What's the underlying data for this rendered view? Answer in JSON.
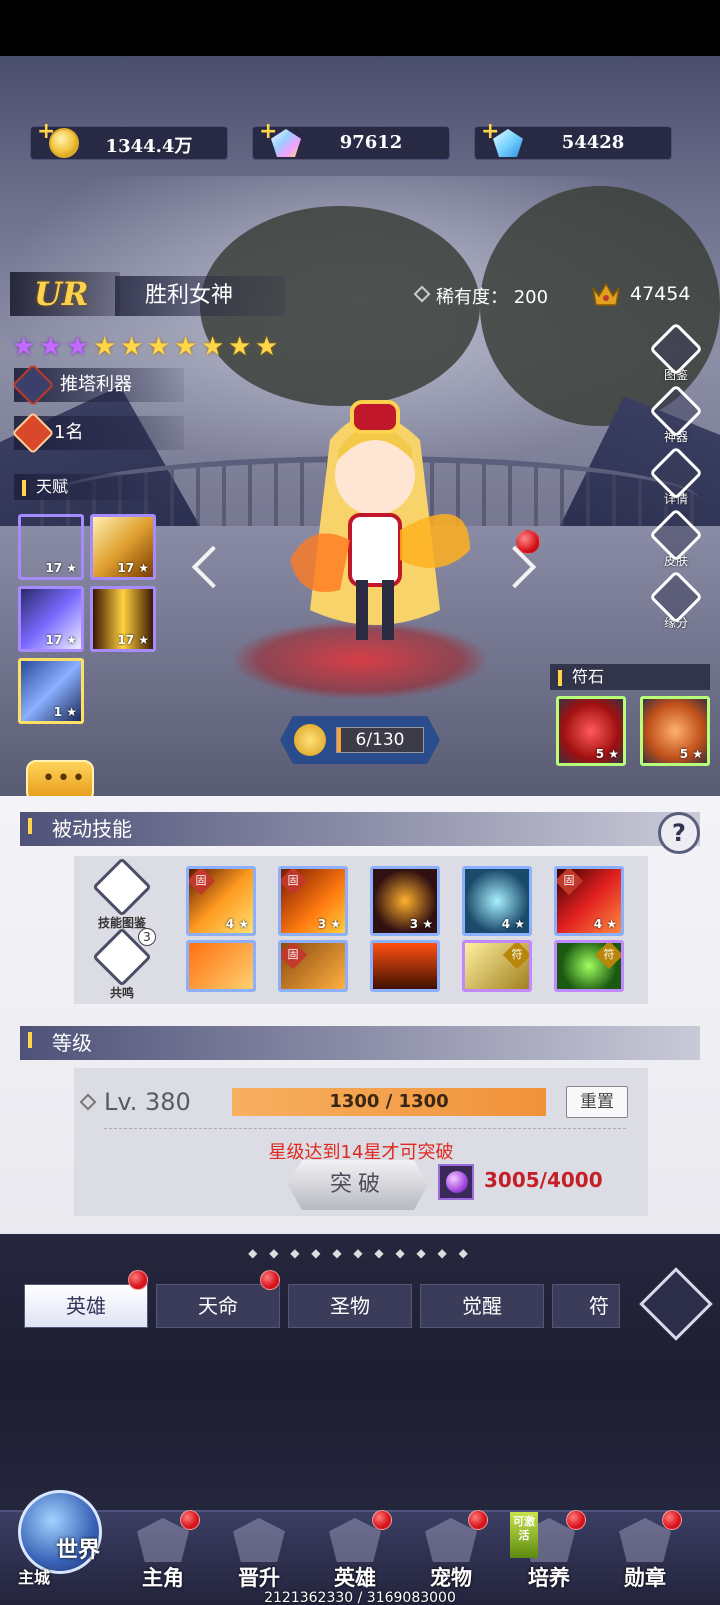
{
  "currencies": [
    {
      "name": "gold",
      "value": "1344.4万"
    },
    {
      "name": "crystal",
      "value": "97612"
    },
    {
      "name": "diamond",
      "value": "54428"
    }
  ],
  "hero": {
    "grade": "UR",
    "name": "胜利女神",
    "rarity_label": "稀有度：",
    "rarity_value": "200",
    "power": "47454",
    "stars_purple": 3,
    "stars_gold": 7,
    "tag": "推塔利器",
    "rank": "1名",
    "talent_title": "天赋",
    "talents": [
      {
        "level": "17"
      },
      {
        "level": "17"
      },
      {
        "level": "17"
      },
      {
        "level": "17"
      },
      {
        "level": "1"
      }
    ],
    "star_progress": "6/130",
    "star_progress_fraction": 0.046
  },
  "side_buttons": [
    "图鉴",
    "神器",
    "详情",
    "皮肤",
    "缘分"
  ],
  "runes": {
    "title": "符石",
    "items": [
      {
        "level": "5"
      },
      {
        "level": "5"
      }
    ]
  },
  "passive": {
    "title": "被动技能",
    "help": "?",
    "left_buttons": [
      {
        "label": "技能图鉴"
      },
      {
        "label": "共鸣",
        "count": "3"
      }
    ],
    "skills_row1": [
      {
        "tag": "固",
        "level": "4"
      },
      {
        "tag": "固",
        "level": "3"
      },
      {
        "tag": "",
        "level": "3"
      },
      {
        "tag": "",
        "level": "4"
      },
      {
        "tag": "固",
        "level": "4"
      }
    ],
    "skills_row2": [
      {
        "tag": ""
      },
      {
        "tag": "固"
      },
      {
        "tag": ""
      },
      {
        "tag": "符"
      },
      {
        "tag": "符"
      }
    ]
  },
  "level": {
    "title": "等级",
    "label": "Lv. 380",
    "exp": "1300 / 1300",
    "reset": "重置",
    "warning": "星级达到14星才可突破",
    "breakthrough": "突破",
    "material": "3005/4000"
  },
  "tabs": [
    {
      "label": "英雄",
      "active": true
    },
    {
      "label": "天命"
    },
    {
      "label": "圣物"
    },
    {
      "label": "觉醒"
    },
    {
      "label": "符文"
    }
  ],
  "nav": {
    "world": "世界",
    "main_city": "主城",
    "items": [
      "主角",
      "晋升",
      "英雄",
      "宠物",
      "培养",
      "勋章"
    ],
    "activate_badge": "可激活",
    "exp_text": "2121362330 / 3169083000"
  }
}
